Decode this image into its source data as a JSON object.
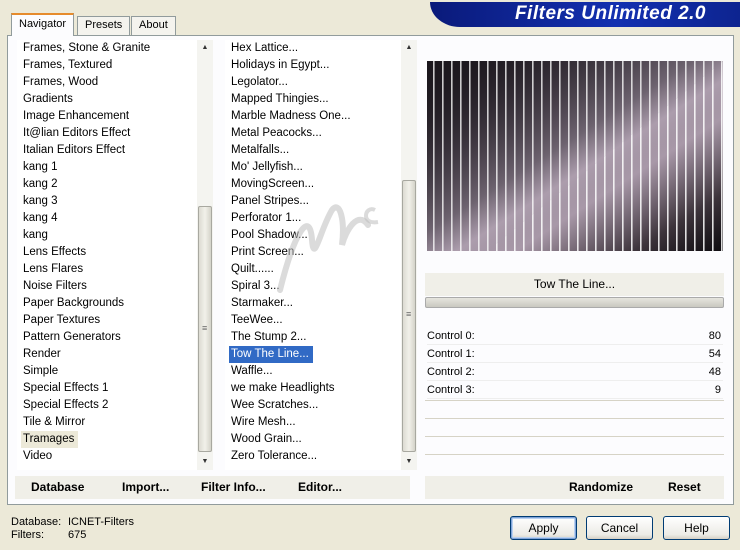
{
  "tabs": [
    {
      "label": "Navigator"
    },
    {
      "label": "Presets"
    },
    {
      "label": "About"
    }
  ],
  "banner": {
    "title": "Filters Unlimited 2.0"
  },
  "categories": {
    "items": [
      "Frames, Stone & Granite",
      "Frames, Textured",
      "Frames, Wood",
      "Gradients",
      "Image Enhancement",
      "It@lian Editors Effect",
      "Italian Editors Effect",
      "kang 1",
      "kang 2",
      "kang 3",
      "kang 4",
      "kang",
      "Lens Effects",
      "Lens Flares",
      "Noise Filters",
      "Paper Backgrounds",
      "Paper Textures",
      "Pattern Generators",
      "Render",
      "Simple",
      "Special Effects 1",
      "Special Effects 2",
      "Tile & Mirror",
      "Tramages",
      "Video"
    ],
    "selected": "Tramages"
  },
  "filters": {
    "items": [
      "Hex Lattice...",
      "Holidays in Egypt...",
      "Legolator...",
      "Mapped Thingies...",
      "Marble Madness One...",
      "Metal Peacocks...",
      "Metalfalls...",
      "Mo' Jellyfish...",
      "MovingScreen...",
      "Panel Stripes...",
      "Perforator 1...",
      "Pool Shadow...",
      "Print Screen...",
      "Quilt......",
      "Spiral 3...",
      "Starmaker...",
      "TeeWee...",
      "The Stump 2...",
      "Tow The Line...",
      "Waffle...",
      "we make Headlights",
      "Wee Scratches...",
      "Wire Mesh...",
      "Wood Grain...",
      "Zero Tolerance..."
    ],
    "selected": "Tow The Line..."
  },
  "current_filter": {
    "name": "Tow The Line..."
  },
  "controls": [
    {
      "label": "Control 0:",
      "value": "80"
    },
    {
      "label": "Control 1:",
      "value": "54"
    },
    {
      "label": "Control 2:",
      "value": "48"
    },
    {
      "label": "Control 3:",
      "value": "9"
    }
  ],
  "bottom_left": {
    "database": "Database",
    "import": "Import...",
    "filter_info": "Filter Info...",
    "editor": "Editor..."
  },
  "bottom_right": {
    "randomize": "Randomize",
    "reset": "Reset"
  },
  "info": {
    "database_label": "Database:",
    "database_value": "ICNET-Filters",
    "filters_label": "Filters:",
    "filters_value": "675"
  },
  "buttons": {
    "apply": "Apply",
    "cancel": "Cancel",
    "help": "Help"
  },
  "colors": {
    "selection": "#316ac5",
    "banner": "#1330b0",
    "tab_accent": "#e68b2c"
  }
}
